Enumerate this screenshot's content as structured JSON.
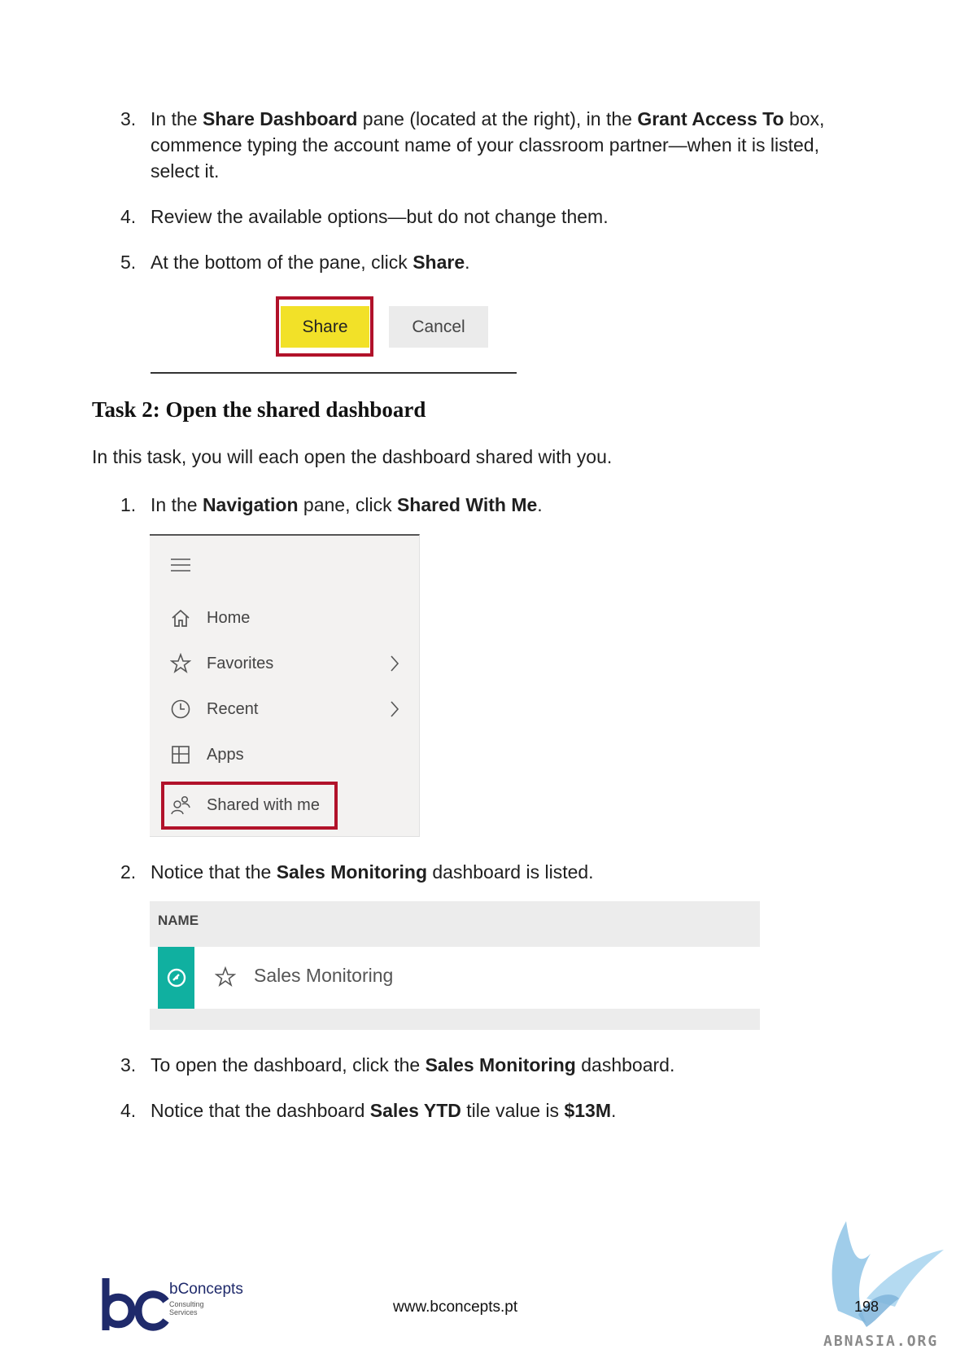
{
  "steps_top": [
    {
      "num": "3.",
      "parts": [
        [
          "In the ",
          ""
        ],
        [
          "Share Dashboard",
          "b"
        ],
        [
          " pane (located at the right), in the ",
          ""
        ],
        [
          "Grant Access To",
          "b"
        ],
        [
          " box,",
          ""
        ]
      ],
      "line2": "commence typing the account name of your classroom partner—when it is listed,",
      "line3": "select it."
    },
    {
      "num": "4.",
      "text": "Review the available options—but do not change them."
    },
    {
      "num": "5.",
      "pre": "At the bottom of the pane, click ",
      "bold": "Share",
      "post": "."
    }
  ],
  "share_shot": {
    "share_label": "Share",
    "cancel_label": "Cancel"
  },
  "task": {
    "heading": "Task 2: Open the shared dashboard",
    "intro": "In this task, you will each open the dashboard shared with you."
  },
  "steps_task": [
    {
      "num": "1.",
      "pre": "In the ",
      "b1": "Navigation",
      "mid": " pane, click ",
      "b2": "Shared With Me",
      "post": "."
    },
    {
      "num": "2.",
      "pre": "Notice that the ",
      "b1": "Sales Monitoring",
      "post": " dashboard is listed."
    },
    {
      "num": "3.",
      "pre": "To open the dashboard, click the ",
      "b1": "Sales Monitoring",
      "post": " dashboard."
    },
    {
      "num": "4.",
      "pre": "Notice that the dashboard ",
      "b1": "Sales YTD",
      "mid": " tile value is ",
      "b2": "$13M",
      "post": "."
    }
  ],
  "nav": {
    "items": [
      {
        "label": "Home",
        "icon": "home-icon"
      },
      {
        "label": "Favorites",
        "icon": "star-icon",
        "chevron": true
      },
      {
        "label": "Recent",
        "icon": "clock-icon",
        "chevron": true
      },
      {
        "label": "Apps",
        "icon": "apps-icon"
      },
      {
        "label": "Shared with me",
        "icon": "shared-people-icon"
      }
    ]
  },
  "list": {
    "header": "NAME",
    "item": "Sales Monitoring",
    "tile_color": "#10b0a0"
  },
  "footer": {
    "brand": "bConcepts",
    "brand_sub": "Consulting Services",
    "website": "www.bconcepts.pt",
    "page": "198",
    "watermark": "ABNASIA.ORG"
  },
  "colors": {
    "highlight": "#b1122a",
    "share_button": "#f2e128",
    "brand_blue": "#1f2a6b"
  }
}
